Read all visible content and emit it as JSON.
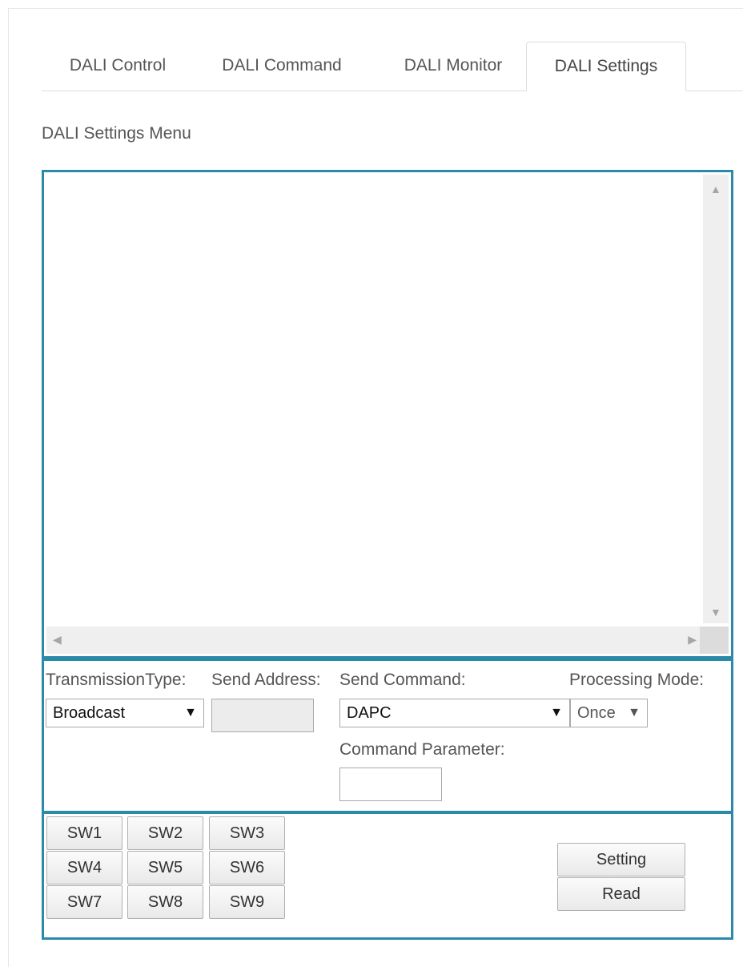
{
  "tabs": [
    {
      "label": "DALI Control"
    },
    {
      "label": "DALI Command"
    },
    {
      "label": "DALI Monitor"
    },
    {
      "label": "DALI Settings",
      "active": true
    }
  ],
  "menu_title": "DALI Settings Menu",
  "controls": {
    "transmission_type": {
      "label": "TransmissionType:",
      "value": "Broadcast"
    },
    "send_address": {
      "label": "Send Address:",
      "value": ""
    },
    "send_command": {
      "label": "Send Command:",
      "value": "DAPC"
    },
    "processing_mode": {
      "label": "Processing Mode:",
      "value": "Once"
    },
    "command_parameter": {
      "label": "Command Parameter:",
      "value": ""
    }
  },
  "switches": [
    "SW1",
    "SW2",
    "SW3",
    "SW4",
    "SW5",
    "SW6",
    "SW7",
    "SW8",
    "SW9"
  ],
  "actions": {
    "setting": "Setting",
    "read": "Read"
  },
  "icons": {
    "caret": "▼",
    "scroll_up": "▲",
    "scroll_down": "▼",
    "scroll_left": "◀",
    "scroll_right": "▶"
  },
  "colors": {
    "panel_border": "#2a8aa8"
  }
}
